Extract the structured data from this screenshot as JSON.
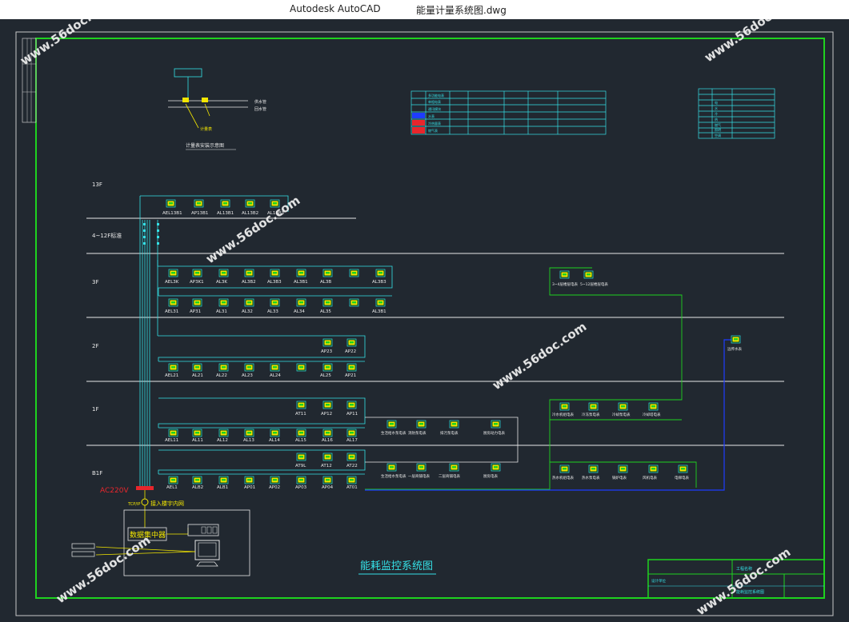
{
  "window": {
    "app_title": "Autodesk AutoCAD",
    "document_title": "能量计量系统图.dwg"
  },
  "drawing": {
    "main_title": "能耗监控系统图",
    "floors": [
      "13F",
      "4~12F标准",
      "3F",
      "2F",
      "1F",
      "B1F"
    ],
    "power_label": "AC220V",
    "network_label": "接入楼宇内网",
    "network_tag": "TCP/IP",
    "collector_label": "数据集中器",
    "meter_detail_title": "计量表安装示意图",
    "pipe_label_1": "供水管",
    "pipe_label_2": "回水管",
    "meter_label": "计量表",
    "watermark": "www.56doc.com",
    "floor_13_meters": [
      "AEL13B1",
      "AP13B1",
      "AL13B1",
      "AL13B2",
      "AL13B3"
    ],
    "floor_3_upper_meters": [
      "AEL3K",
      "AP3K1",
      "AL3K",
      "AL3B2",
      "AL3B3",
      "AL3B1",
      "AL3B",
      "AL3B3"
    ],
    "floor_3_lower_meters": [
      "AEL31",
      "AP31",
      "AL31",
      "AL32",
      "AL33",
      "AL34",
      "AL35",
      "AL3B1"
    ],
    "floor_2_upper_meters": [
      "AP23",
      "AP22"
    ],
    "floor_2_lower_meters": [
      "AEL21",
      "AL21",
      "AL22",
      "AL23",
      "AL24",
      "AL25",
      "AP21"
    ],
    "floor_1_upper_meters": [
      "AT11",
      "AP12",
      "AP11"
    ],
    "floor_1_lower_meters": [
      "AEL11",
      "AL11",
      "AL12",
      "AL13",
      "AL14",
      "AL15",
      "AL16",
      "AL17"
    ],
    "b1_upper_meters": [
      "AT9L",
      "AT12",
      "AT22"
    ],
    "b1_lower_meters": [
      "AEL1",
      "ALB2",
      "ALB1",
      "AP01",
      "AP02",
      "AP03",
      "AP04",
      "AT01"
    ],
    "legend_left_rows": [
      "多功能电表",
      "单相电表",
      "通讯模块",
      "水表",
      "冷热量表",
      "燃气表"
    ],
    "legend_right_rows": [
      "电",
      "水",
      "冷",
      "热",
      "燃气",
      "照明",
      "空调"
    ],
    "right_group_top": [
      "3~4层楼层电表",
      "5~12层楼层电表"
    ],
    "right_group_mid": [
      "冷水机组电表",
      "冷冻泵电表",
      "冷却泵电表",
      "冷却塔电表"
    ],
    "right_group_bottom": [
      "热水机组电表",
      "热水泵电表",
      "锅炉电表",
      "风机电表",
      "电梯电表"
    ],
    "mid_group_top": [
      "生活给水泵电表",
      "消防泵电表",
      "排污泵电表",
      "厨房动力电表"
    ],
    "mid_group_bottom": [
      "生活给水泵电表",
      "一层商铺电表",
      "二层商铺电表",
      "厨房电表"
    ],
    "remote_label": "远传水表",
    "title_block": [
      "设计单位",
      "工程名称",
      "能耗监控系统图"
    ]
  },
  "colors": {
    "frame_green": "#1fd21f",
    "cyan": "#35e0e6",
    "white": "#e8e8e8",
    "yellow": "#f3e600",
    "red": "#e8262c",
    "blue": "#1e3cff"
  }
}
